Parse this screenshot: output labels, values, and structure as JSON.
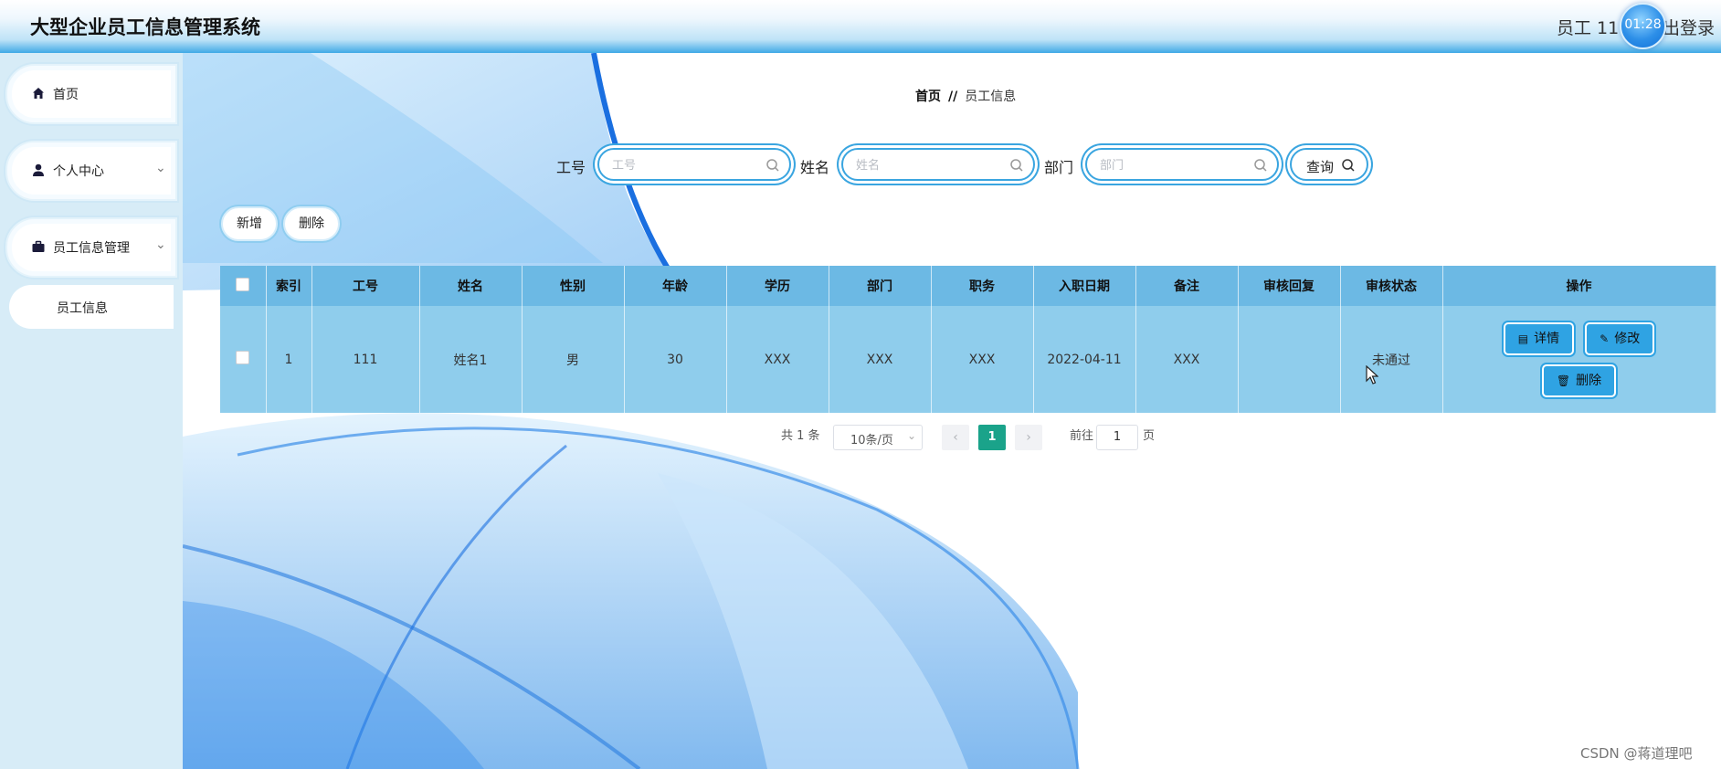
{
  "header": {
    "title": "大型企业员工信息管理系统",
    "user_label": "员工 11",
    "clock": "01:28",
    "logout_label": "出登录"
  },
  "sidebar": {
    "items": [
      {
        "label": "首页",
        "icon": "home-icon"
      },
      {
        "label": "个人中心",
        "icon": "user-icon"
      },
      {
        "label": "员工信息管理",
        "icon": "briefcase-icon"
      }
    ],
    "sub_item": "员工信息"
  },
  "breadcrumb": {
    "home": "首页",
    "separator": "//",
    "current": "员工信息"
  },
  "search": {
    "emp_no_label": "工号",
    "emp_no_placeholder": "工号",
    "name_label": "姓名",
    "name_placeholder": "姓名",
    "dept_label": "部门",
    "dept_placeholder": "部门",
    "query_label": "查询"
  },
  "actions": {
    "add_label": "新增",
    "delete_label": "删除"
  },
  "table": {
    "headers": [
      "索引",
      "工号",
      "姓名",
      "性别",
      "年龄",
      "学历",
      "部门",
      "职务",
      "入职日期",
      "备注",
      "审核回复",
      "审核状态",
      "操作"
    ],
    "rows": [
      {
        "index": "1",
        "emp_no": "111",
        "name": "姓名1",
        "gender": "男",
        "age": "30",
        "education": "XXX",
        "dept": "XXX",
        "position": "XXX",
        "hire_date": "2022-04-11",
        "remark": "XXX",
        "review_reply": "",
        "review_status": "未通过"
      }
    ],
    "row_ops": {
      "detail": "详情",
      "edit": "修改",
      "delete": "删除"
    }
  },
  "pagination": {
    "total_text": "共 1 条",
    "page_size": "10条/页",
    "current_page": "1",
    "goto_prefix": "前往",
    "goto_value": "1",
    "goto_suffix": "页"
  },
  "watermark": "CSDN @蒋道理吧",
  "colors": {
    "accent": "#2fa3e3",
    "table_header": "#6cb9e4",
    "table_row": "#8fcdec",
    "page_active": "#1aa38a"
  }
}
